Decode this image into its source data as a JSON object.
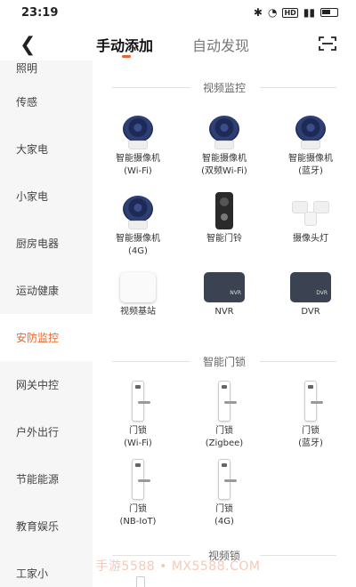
{
  "status": {
    "time": "23:19",
    "icons": [
      "bluetooth-icon",
      "wifi-icon",
      "hd-badge",
      "signal-icon",
      "battery-icon"
    ]
  },
  "header": {
    "tabs": [
      {
        "label": "手动添加",
        "active": true
      },
      {
        "label": "自动发现",
        "active": false
      }
    ]
  },
  "colors": {
    "accent": "#e8652b"
  },
  "sidebar": {
    "items": [
      {
        "label": "照明"
      },
      {
        "label": "传感"
      },
      {
        "label": "大家电"
      },
      {
        "label": "小家电"
      },
      {
        "label": "厨房电器"
      },
      {
        "label": "运动健康"
      },
      {
        "label": "安防监控",
        "active": true
      },
      {
        "label": "网关中控"
      },
      {
        "label": "户外出行"
      },
      {
        "label": "节能能源"
      },
      {
        "label": "教育娱乐"
      },
      {
        "label": "工家小"
      }
    ]
  },
  "sections": [
    {
      "title": "视频监控",
      "items": [
        {
          "name": "智能摄像机",
          "sub": "(Wi-Fi)",
          "icon": "camera"
        },
        {
          "name": "智能摄像机",
          "sub": "(双频Wi-Fi)",
          "icon": "camera"
        },
        {
          "name": "智能摄像机",
          "sub": "(蓝牙)",
          "icon": "camera"
        },
        {
          "name": "智能摄像机",
          "sub": "(4G)",
          "icon": "camera"
        },
        {
          "name": "智能门铃",
          "sub": "",
          "icon": "doorbell"
        },
        {
          "name": "摄像头灯",
          "sub": "",
          "icon": "floodlight"
        },
        {
          "name": "视频基站",
          "sub": "",
          "icon": "hub"
        },
        {
          "name": "NVR",
          "sub": "",
          "icon": "box",
          "box_label": "NVR"
        },
        {
          "name": "DVR",
          "sub": "",
          "icon": "box",
          "box_label": "DVR"
        }
      ]
    },
    {
      "title": "智能门锁",
      "items": [
        {
          "name": "门锁",
          "sub": "(Wi-Fi)",
          "icon": "lock"
        },
        {
          "name": "门锁",
          "sub": "(Zigbee)",
          "icon": "lock"
        },
        {
          "name": "门锁",
          "sub": "(蓝牙)",
          "icon": "lock"
        },
        {
          "name": "门锁",
          "sub": "(NB-IoT)",
          "icon": "lock"
        },
        {
          "name": "门锁",
          "sub": "(4G)",
          "icon": "lock"
        }
      ]
    },
    {
      "title": "视频锁",
      "items": []
    }
  ],
  "watermark": "手游5588 • MX5588.COM"
}
